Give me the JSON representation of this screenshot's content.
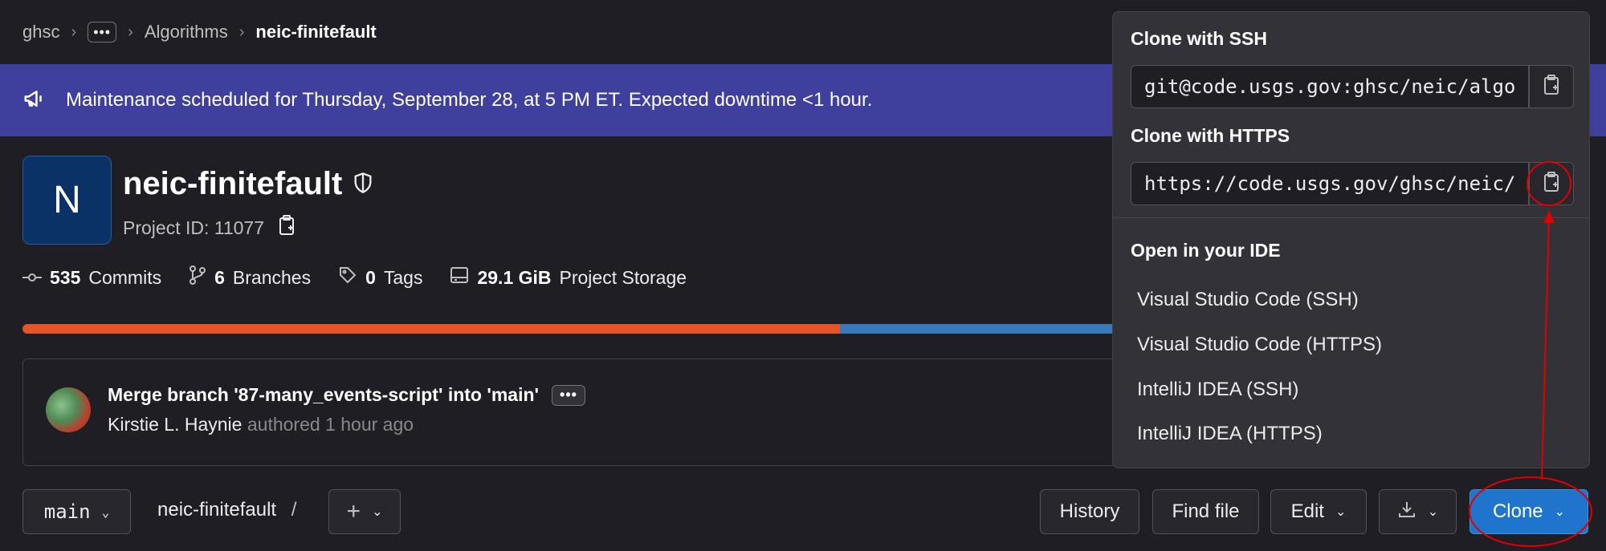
{
  "breadcrumb": {
    "items": [
      "ghsc",
      "Algorithms",
      "neic-finitefault"
    ],
    "more": "•••"
  },
  "banner": {
    "text": "Maintenance scheduled for Thursday, September 28, at 5 PM ET. Expected downtime <1 hour."
  },
  "project": {
    "avatar_letter": "N",
    "name": "neic-finitefault",
    "id_label": "Project ID: 11077"
  },
  "stats": {
    "commits_count": "535",
    "commits_label": "Commits",
    "branches_count": "6",
    "branches_label": "Branches",
    "tags_count": "0",
    "tags_label": "Tags",
    "storage_count": "29.1 GiB",
    "storage_label": "Project Storage"
  },
  "commit": {
    "title": "Merge branch '87-many_events-script' into 'main'",
    "author": "Kirstie L. Haynie",
    "meta": "authored 1 hour ago",
    "more": "•••"
  },
  "toolbar": {
    "branch": "main",
    "path": "neic-finitefault",
    "path_sep": "/",
    "plus": "+",
    "history": "History",
    "find_file": "Find file",
    "edit": "Edit",
    "clone": "Clone"
  },
  "clone_dropdown": {
    "ssh_title": "Clone with SSH",
    "ssh_url": "git@code.usgs.gov:ghsc/neic/algo",
    "https_title": "Clone with HTTPS",
    "https_url": "https://code.usgs.gov/ghsc/neic/",
    "ide_title": "Open in your IDE",
    "ide_items": [
      "Visual Studio Code (SSH)",
      "Visual Studio Code (HTTPS)",
      "IntelliJ IDEA (SSH)",
      "IntelliJ IDEA (HTTPS)"
    ]
  },
  "colors": {
    "banner": "#3f3f9e",
    "clone_button": "#1f75cb",
    "annotation": "#e00000",
    "lang_primary": "#e4562a",
    "lang_secondary": "#3b78b8"
  },
  "language_bar": {
    "primary_fraction": 0.727,
    "secondary_fraction": 0.273
  }
}
